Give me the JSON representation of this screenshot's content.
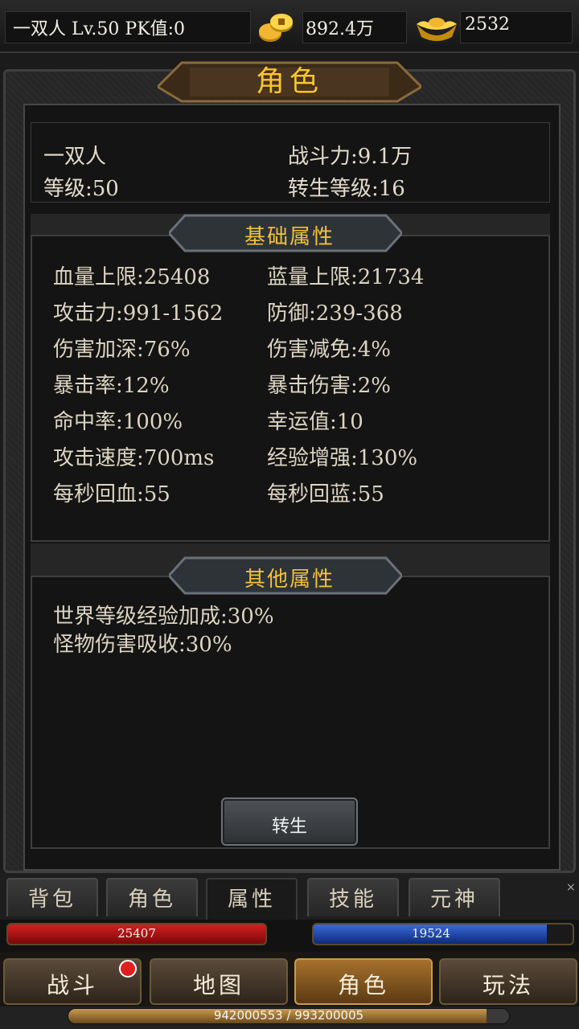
{
  "topbar": {
    "player": "一双人  Lv.50 PK值:0",
    "gold": "892.4万",
    "ingot": "2532"
  },
  "panel": {
    "title": "角色",
    "name": "一双人",
    "power": "战斗力:9.1万",
    "level": "等级:50",
    "rebirth_level": "转生等级:16"
  },
  "basic": {
    "title": "基础属性",
    "left": [
      "血量上限:25408",
      "攻击力:991-1562",
      "伤害加深:76%",
      "暴击率:12%",
      "命中率:100%",
      "攻击速度:700ms",
      "每秒回血:55"
    ],
    "right": [
      "蓝量上限:21734",
      "防御:239-368",
      "伤害减免:4%",
      "暴击伤害:2%",
      "幸运值:10",
      "经验增强:130%",
      "每秒回蓝:55"
    ]
  },
  "other": {
    "title": "其他属性",
    "items": [
      "世界等级经验加成:30%",
      "怪物伤害吸收:30%"
    ]
  },
  "rebirth_button": "转生",
  "tabs": [
    "背包",
    "角色",
    "属性",
    "技能",
    "元神"
  ],
  "active_tab": "属性",
  "close_glyph": "×",
  "hp": {
    "value": "25407",
    "fill": 1.0
  },
  "mp": {
    "value": "19524",
    "fill": 0.9
  },
  "nav": [
    "战斗",
    "地图",
    "角色",
    "玩法"
  ],
  "active_nav": "角色",
  "exp": {
    "text": "942000553 / 993200005",
    "fill": 0.948
  },
  "colors": {
    "gold_text": "#f6c630",
    "hp": "#d42020",
    "mp": "#3a6ad8",
    "nav_active": "#a7712d",
    "badge": "#e02020"
  },
  "icons": [
    "gold-coin-icon",
    "gold-ingot-icon",
    "notification-dot"
  ]
}
